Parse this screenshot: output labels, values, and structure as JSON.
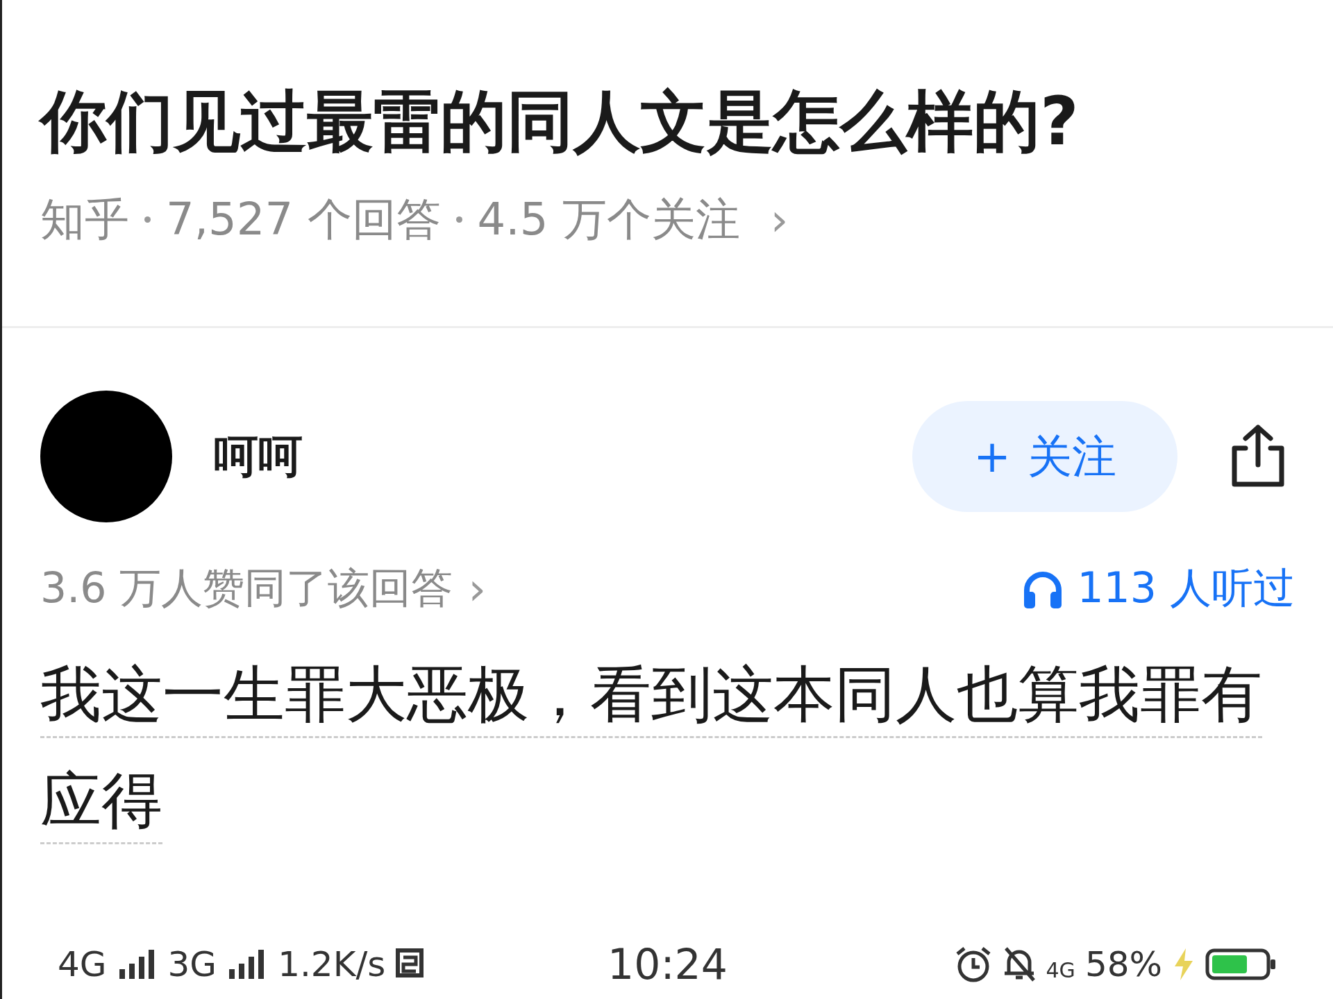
{
  "question": {
    "title": "你们见过最雷的同人文是怎么样的?",
    "meta": [
      "知乎",
      "7,527 个回答",
      "4.5 万个关注"
    ],
    "chevron": "›"
  },
  "answer": {
    "author": "呵呵",
    "follow_button": {
      "icon": "+",
      "label": "关注"
    },
    "upvotes": "3.6 万人赞同了该回答",
    "upvotes_chevron": "›",
    "listens": "113 人听过",
    "body": [
      "我这一生罪大恶极，看到这本同人也算我罪有",
      "应得"
    ]
  },
  "status_bar": {
    "left": [
      {
        "kind": "text",
        "text": "4G"
      },
      {
        "kind": "signal"
      },
      {
        "kind": "text",
        "text": "3G"
      },
      {
        "kind": "signal"
      },
      {
        "kind": "text",
        "text": "1.2K/s"
      },
      {
        "kind": "nfc"
      }
    ],
    "time": "10:24",
    "right": [
      {
        "kind": "alarm"
      },
      {
        "kind": "mute"
      },
      {
        "kind": "small",
        "text": "4G"
      },
      {
        "kind": "text",
        "text": "58%"
      },
      {
        "kind": "bolt"
      },
      {
        "kind": "battery"
      }
    ]
  }
}
